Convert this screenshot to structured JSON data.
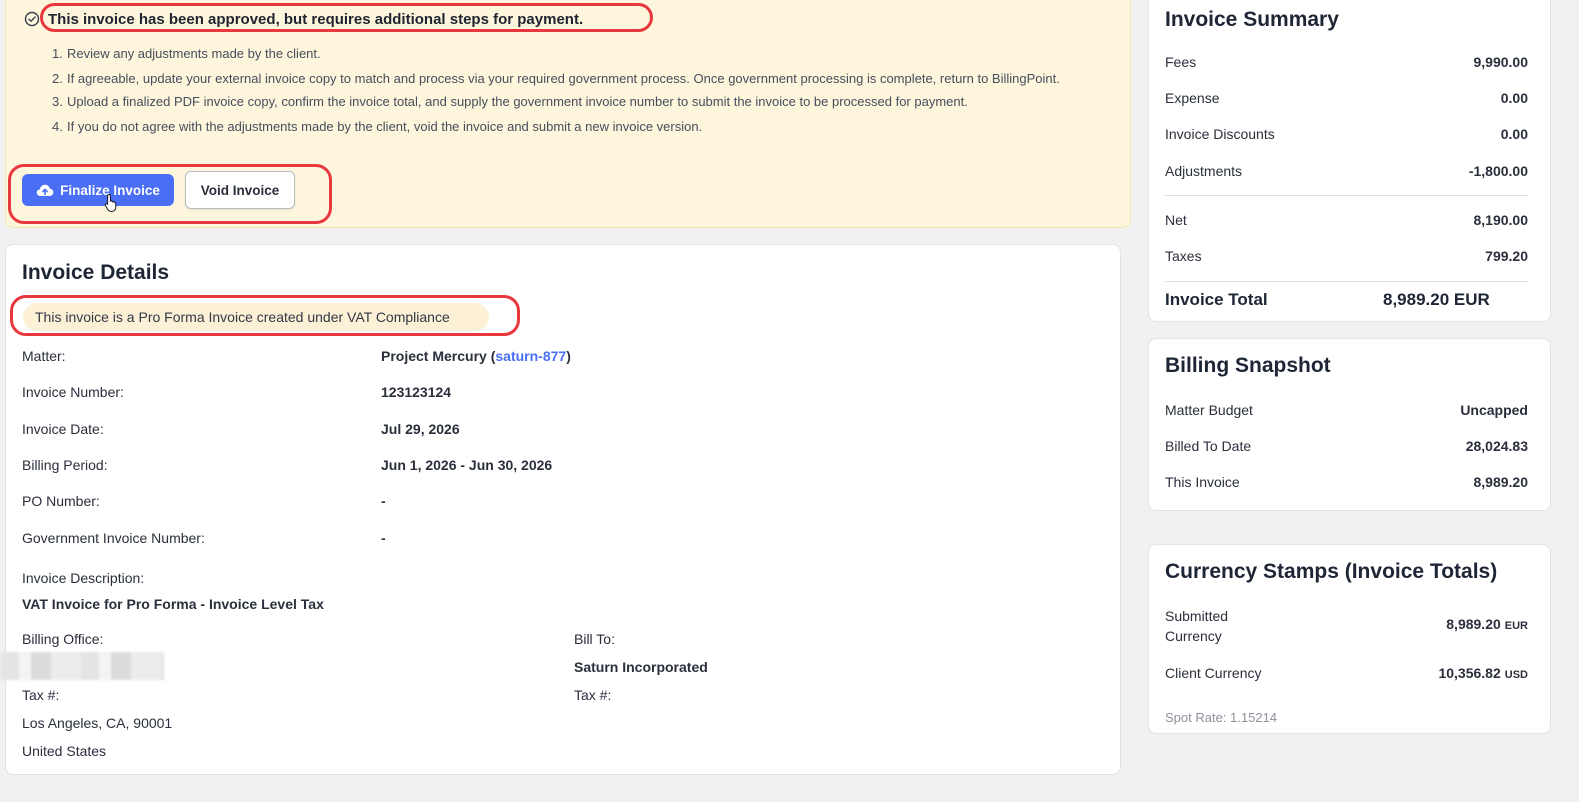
{
  "banner": {
    "title": "This invoice has been approved, but requires additional steps for payment.",
    "steps": [
      {
        "num": "1.",
        "text": "Review any adjustments made by the client."
      },
      {
        "num": "2.",
        "text": "If agreeable, update your external invoice copy to match and process via your required government process. Once government processing is complete, return to BillingPoint."
      },
      {
        "num": "3.",
        "text": "Upload a finalized PDF invoice copy, confirm the invoice total, and supply the government invoice number to submit the invoice to be processed for payment."
      },
      {
        "num": "4.",
        "text": "If you do not agree with the adjustments made by the client, void the invoice and submit a new invoice version."
      }
    ],
    "finalize_label": "Finalize Invoice",
    "void_label": "Void Invoice"
  },
  "details": {
    "title": "Invoice Details",
    "vat_note": "This invoice is a Pro Forma Invoice created under VAT Compliance",
    "matter_label": "Matter:",
    "matter_name": "Project Mercury (",
    "matter_code": "saturn-877",
    "matter_close": ")",
    "invoice_number_label": "Invoice Number:",
    "invoice_number": "123123124",
    "invoice_date_label": "Invoice Date:",
    "invoice_date": "Jul 29, 2026",
    "billing_period_label": "Billing Period:",
    "billing_period": "Jun 1, 2026 - Jun 30, 2026",
    "po_label": "PO Number:",
    "po_value": "-",
    "gov_label": "Government Invoice Number:",
    "gov_value": "-",
    "desc_label": "Invoice Description:",
    "desc_value": "VAT Invoice for Pro Forma - Invoice Level Tax",
    "billing_office_label": "Billing Office:",
    "bill_to_label": "Bill To:",
    "bill_to_name": "Saturn Incorporated",
    "tax_label_left": "Tax #:",
    "tax_label_right": "Tax #:",
    "address_city": "Los Angeles, CA, 90001",
    "address_country": "United States"
  },
  "summary": {
    "title": "Invoice Summary",
    "fees_label": "Fees",
    "fees": "9,990.00",
    "expense_label": "Expense",
    "expense": "0.00",
    "discounts_label": "Invoice Discounts",
    "discounts": "0.00",
    "adjustments_label": "Adjustments",
    "adjustments": "-1,800.00",
    "net_label": "Net",
    "net": "8,190.00",
    "taxes_label": "Taxes",
    "taxes": "799.20",
    "total_label": "Invoice Total",
    "total": "8,989.20 EUR"
  },
  "snapshot": {
    "title": "Billing Snapshot",
    "budget_label": "Matter Budget",
    "budget": "Uncapped",
    "billed_label": "Billed To Date",
    "billed": "28,024.83",
    "this_label": "This Invoice",
    "this": "8,989.20"
  },
  "stamps": {
    "title": "Currency Stamps (Invoice Totals)",
    "submitted_label_1": "Submitted",
    "submitted_label_2": "Currency",
    "submitted_value": "8,989.20",
    "submitted_cur": "EUR",
    "client_label": "Client Currency",
    "client_value": "10,356.82",
    "client_cur": "USD",
    "spot_rate": "Spot Rate: 1.15214"
  },
  "colors": {
    "accent": "#4a6ff4",
    "banner_bg": "#fdf6dc",
    "highlight": "#e8383d"
  }
}
